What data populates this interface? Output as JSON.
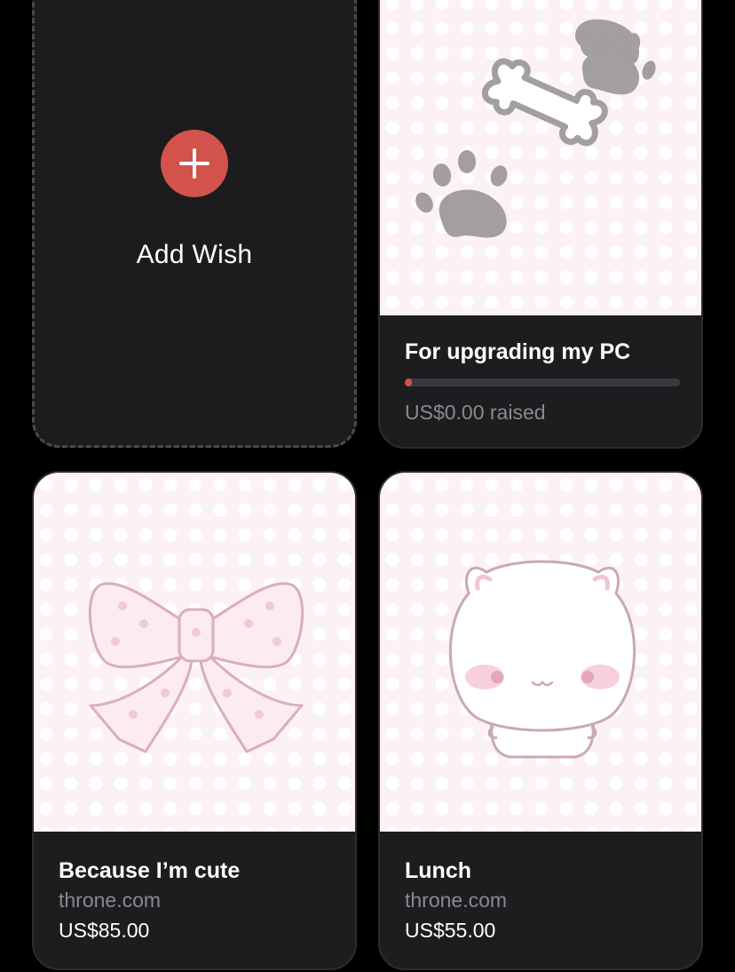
{
  "add_wish": {
    "label": "Add Wish",
    "icon": "plus-icon",
    "accent": "#d2534b"
  },
  "wishes": [
    {
      "title": "For upgrading my PC",
      "image_icon": "paws-and-bone-image",
      "progress": 0.0,
      "raised_text": "US$0.00 raised"
    },
    {
      "title": "Because I’m cute",
      "image_icon": "pink-bow-image",
      "site": "throne.com",
      "price": "US$85.00"
    },
    {
      "title": "Lunch",
      "image_icon": "white-cat-image",
      "site": "throne.com",
      "price": "US$55.00"
    }
  ]
}
